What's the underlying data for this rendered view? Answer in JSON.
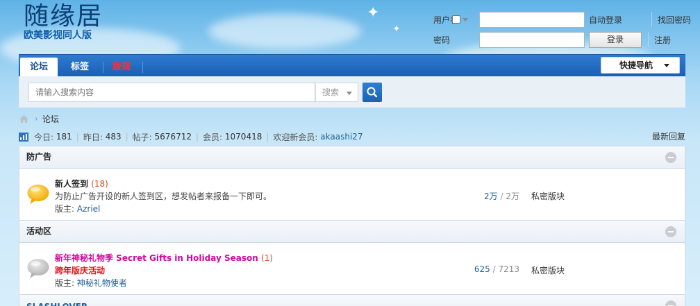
{
  "brand": {
    "title": "随缘居",
    "subtitle": "欧美影视同人版"
  },
  "login": {
    "username_label": "用户名",
    "password_label": "密码",
    "autologin_label": "自动登录",
    "login_button": "登录",
    "forgot_password": "找回密码",
    "register": "注册",
    "username_value": "",
    "password_value": ""
  },
  "nav": {
    "tabs": [
      {
        "label": "论坛",
        "active": true
      },
      {
        "label": "标签",
        "active": false
      },
      {
        "label": "版规",
        "active": false,
        "color": "#ff2e2e"
      }
    ],
    "quick_nav": "快捷导航"
  },
  "search": {
    "placeholder": "请输入搜索内容",
    "scope": "搜索"
  },
  "breadcrumb": {
    "current": "论坛"
  },
  "stats": {
    "today_label": "今日:",
    "today": "181",
    "yesterday_label": "昨日:",
    "yesterday": "483",
    "posts_label": "帖子:",
    "posts": "5676712",
    "members_label": "会员:",
    "members": "1070418",
    "welcome_label": "欢迎新会员:",
    "new_member": "akaashi27",
    "latest_link": "最新回复"
  },
  "sections": [
    {
      "title": "防广告",
      "forum": {
        "name": "新人签到",
        "count": "(18)",
        "description": "为防止广告开设的新人签到区，想发帖者来报备一下即可。",
        "mod_label": "版主:",
        "moderator": "Azriel",
        "threads": "2万",
        "posts": "2万",
        "access": "私密版块",
        "icon_color": "#f5b400"
      }
    },
    {
      "title": "活动区",
      "forum": {
        "name": "新年神秘礼物季 Secret Gifts in Holiday Season",
        "count": "(1)",
        "description": "跨年版庆活动",
        "mod_label": "版主:",
        "moderator": "神秘礼物使者",
        "threads": "625",
        "posts": "7213",
        "access": "私密版块",
        "name_color": "#d0089c",
        "description_color": "#e3101b",
        "icon_color": "#bdbdbd"
      }
    },
    {
      "title": "SLASHLOVER"
    }
  ],
  "colors": {
    "nav_blue": "#1a5fb4",
    "link_blue": "#1f5f99",
    "count_orange": "#e24a1b"
  }
}
